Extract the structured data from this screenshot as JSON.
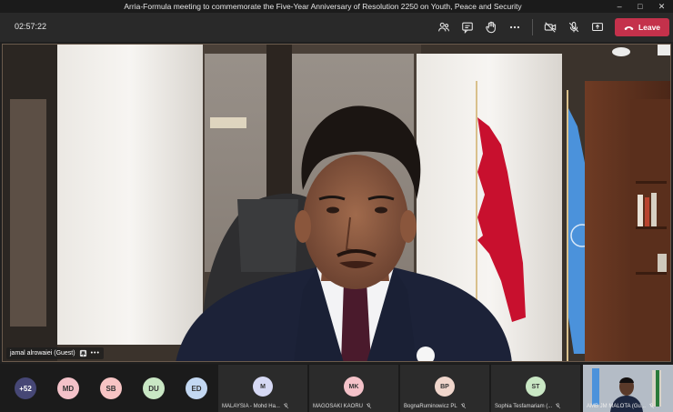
{
  "window": {
    "title": "Arria-Formula meeting to commemorate the Five-Year Anniversary of Resolution 2250 on Youth, Peace and Security"
  },
  "toolbar": {
    "timer": "02:57:22",
    "leave_label": "Leave",
    "icons": [
      "participants-icon",
      "chat-icon",
      "raise-hand-icon",
      "more-icon",
      "camera-off-icon",
      "mic-off-icon",
      "share-icon"
    ]
  },
  "main_video": {
    "speaker_name": "jamal alrowaiei (Guest)",
    "more_label": "•••"
  },
  "participant_strip": {
    "more_count": "+52",
    "avatars": [
      {
        "initials": "MD",
        "color": "#f4c2c9"
      },
      {
        "initials": "SB",
        "color": "#f7c4c4"
      },
      {
        "initials": "DU",
        "color": "#c9e7c4"
      },
      {
        "initials": "ED",
        "color": "#c3d8f2"
      }
    ],
    "tiles": [
      {
        "initials": "M",
        "color": "#d6d9f4",
        "name": "MALAYSIA - Mohd Ha..."
      },
      {
        "initials": "MK",
        "color": "#f4c2c9",
        "name": "MAGOSAKI KAORU"
      },
      {
        "initials": "BP",
        "color": "#f0d6cc",
        "name": "BognaRuminowicz PL"
      },
      {
        "initials": "ST",
        "color": "#c9e7c4",
        "name": "Sophia Tesfamariam (..."
      }
    ],
    "last_tile_name": "AMB JM MALOTA (Gu..."
  }
}
